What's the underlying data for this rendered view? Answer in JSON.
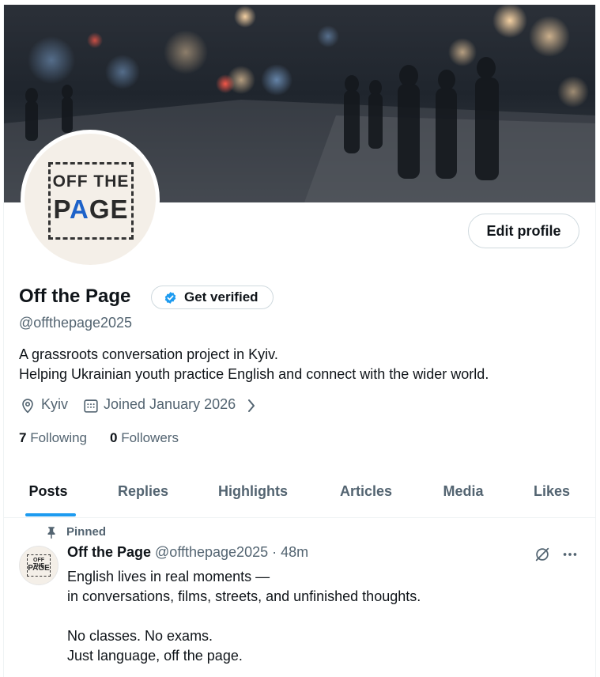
{
  "profile": {
    "avatar_logo_line1": "OFF THE",
    "avatar_logo_line2_pre": "P",
    "avatar_logo_line2_accent": "A",
    "avatar_logo_line2_post": "GE",
    "edit_profile_label": "Edit profile",
    "name": "Off the Page",
    "get_verified_label": "Get verified",
    "handle": "@offthepage2025",
    "bio_line1": "A grassroots conversation project in Kyiv.",
    "bio_line2": "Helping Ukrainian youth practice English and connect with the wider world.",
    "location": "Kyiv",
    "joined": "Joined January 2026",
    "following_count": "7",
    "following_label": "Following",
    "followers_count": "0",
    "followers_label": "Followers"
  },
  "tabs": [
    {
      "label": "Posts",
      "active": true
    },
    {
      "label": "Replies"
    },
    {
      "label": "Highlights"
    },
    {
      "label": "Articles"
    },
    {
      "label": "Media"
    },
    {
      "label": "Likes"
    }
  ],
  "post": {
    "pinned_label": "Pinned",
    "author_name": "Off the Page",
    "author_meta": "@offthepage2025 · 48m",
    "avatar_line1": "OFF THE",
    "avatar_line2": "PAGE",
    "text": "English lives in real moments —\nin conversations, films, streets, and unfinished thoughts.\n\nNo classes. No exams.\nJust language, off the page."
  },
  "colors": {
    "accent": "#1d9bf0",
    "secondary_text": "#536471",
    "primary_text": "#0f1419",
    "logo_accent": "#1d62c9"
  },
  "icons": [
    "location-icon",
    "calendar-icon",
    "chevron-right-icon",
    "verified-badge-icon",
    "pin-icon",
    "grok-icon",
    "more-icon"
  ]
}
